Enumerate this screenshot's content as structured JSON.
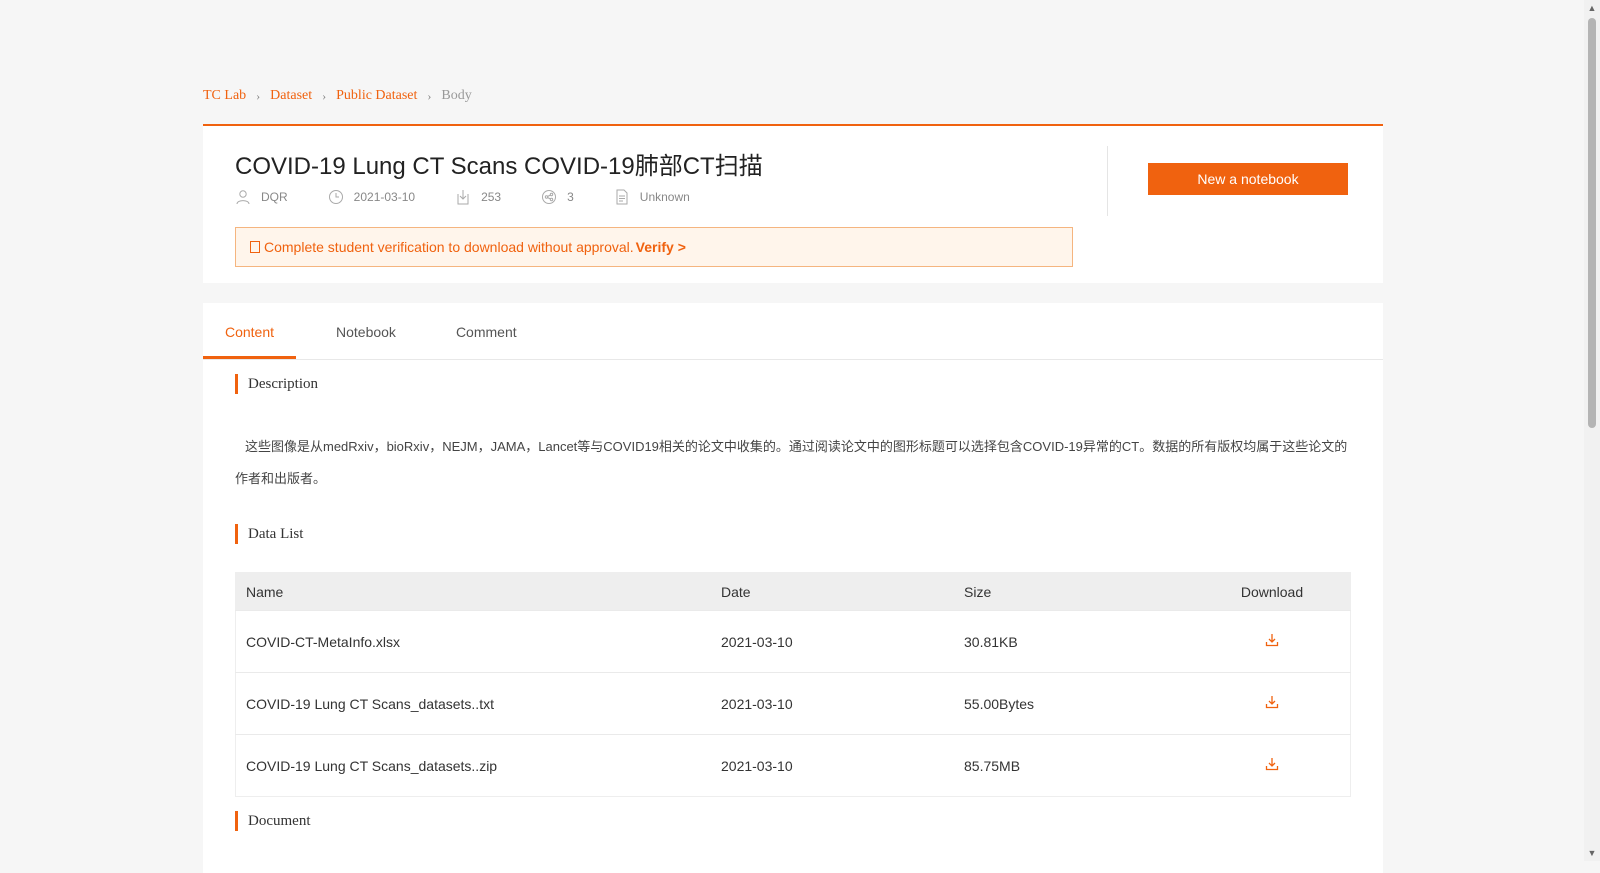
{
  "breadcrumb": [
    "TC Lab",
    "Dataset",
    "Public Dataset",
    "Body"
  ],
  "dataset": {
    "title": "COVID-19 Lung CT Scans COVID-19肺部CT扫描",
    "author": "DQR",
    "date": "2021-03-10",
    "downloads": "253",
    "shares": "3",
    "license": "Unknown"
  },
  "notice": {
    "text": "Complete student verification to download without approval.",
    "link": "Verify >"
  },
  "actions": {
    "new_notebook": "New a notebook"
  },
  "tabs": [
    "Content",
    "Notebook",
    "Comment"
  ],
  "sections": {
    "description_title": "Description",
    "description_text": "这些图像是从medRxiv，bioRxiv，NEJM，JAMA，Lancet等与COVID19相关的论文中收集的。通过阅读论文中的图形标题可以选择包含COVID-19异常的CT。数据的所有版权均属于这些论文的作者和出版者。",
    "data_list_title": "Data List",
    "document_title": "Document"
  },
  "table": {
    "headers": [
      "Name",
      "Date",
      "Size",
      "Download"
    ],
    "rows": [
      [
        "COVID-CT-MetaInfo.xlsx",
        "2021-03-10",
        "30.81KB"
      ],
      [
        "COVID-19 Lung CT Scans_datasets..txt",
        "2021-03-10",
        "55.00Bytes"
      ],
      [
        "COVID-19 Lung CT Scans_datasets..zip",
        "2021-03-10",
        "85.75MB"
      ]
    ]
  },
  "icons": {
    "author": "user-icon",
    "date": "clock-icon",
    "downloads": "download-count-icon",
    "shares": "share-icon",
    "license": "document-icon",
    "download": "download-icon"
  },
  "colors": {
    "accent": "#f0620f",
    "notice_bg": "#fff5eb"
  }
}
